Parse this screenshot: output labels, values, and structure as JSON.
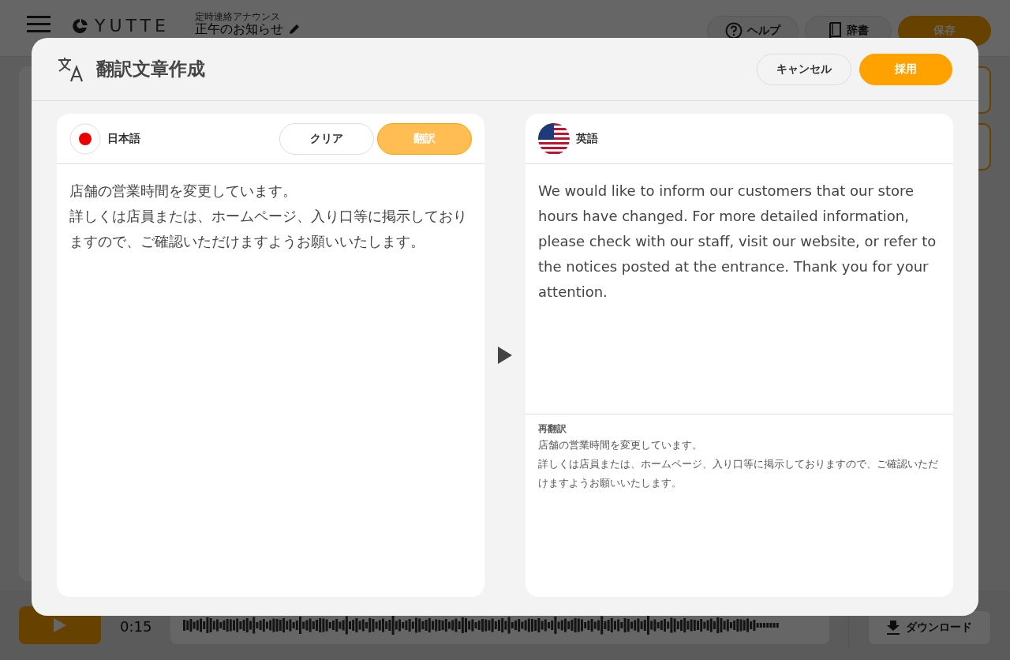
{
  "app": {
    "logo": "YUTTE",
    "subtitle": "定時連絡アナウンス",
    "title": "正午のお知らせ",
    "buttons": [
      {
        "kind": "help",
        "label": "ヘルプ"
      },
      {
        "kind": "dictionary",
        "label": "辞書"
      },
      {
        "kind": "save",
        "label": "保存"
      }
    ],
    "player": {
      "time": "0:15",
      "download": "ダウンロード"
    }
  },
  "dialog": {
    "title": "翻訳文章作成",
    "buttons": [
      {
        "kind": "cancel",
        "label": "キャンセル"
      },
      {
        "kind": "primary",
        "label": "採用"
      }
    ],
    "source": {
      "language": "日本語",
      "buttons": [
        {
          "kind": "clear",
          "label": "クリア"
        },
        {
          "kind": "translate",
          "label": "翻訳"
        }
      ],
      "paragraphs": [
        "店舗の営業時間を変更しています。",
        "詳しくは店員または、ホームページ、入り口等に掲示しておりますので、ご確認いただけますようお願いいたします。"
      ]
    },
    "target": {
      "language": "英語",
      "text": "We would like to inform our customers that our store hours have changed. For more detailed information, please check with our staff, visit our website, or refer to the notices posted at the entrance. Thank you for your attention.",
      "back_translation_label": "再翻訳",
      "back_translation": [
        "店舗の営業時間を変更しています。",
        "詳しくは店員または、ホームページ、入り口等に掲示しておりますので、ご確認いただけますようお願いいたします。"
      ]
    }
  }
}
